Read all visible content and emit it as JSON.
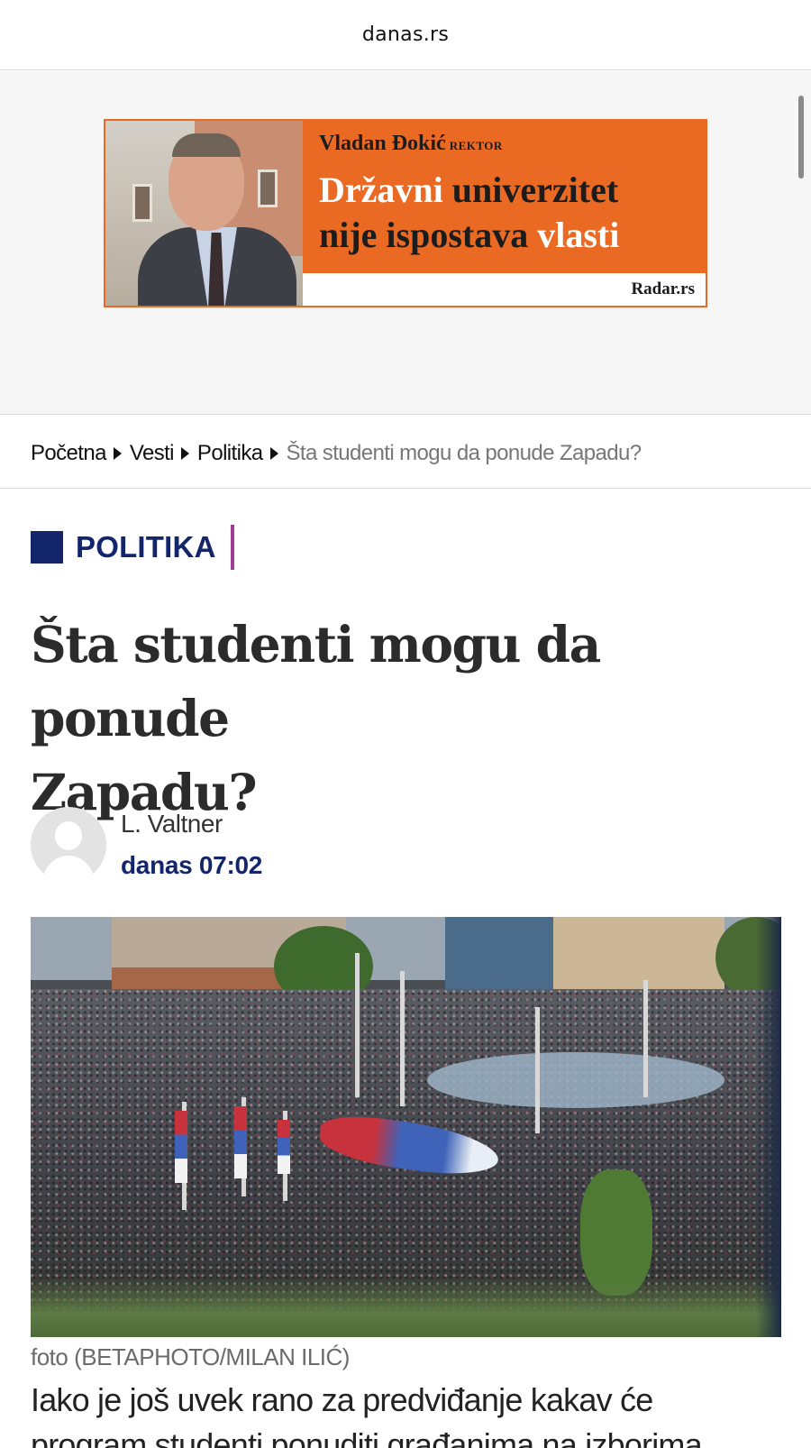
{
  "browser": {
    "url": "danas.rs"
  },
  "ad": {
    "name": "Vladan Đokić",
    "role": "REKTOR",
    "headline_line1_a": "Državni",
    "headline_line1_b": "univerzitet",
    "headline_line2_a": "nije ispostava",
    "headline_line2_b": "vlasti",
    "brand": "Radar.rs",
    "colors": {
      "background": "#ea6a24",
      "text": "#1c1c1c",
      "highlight": "#ffffff"
    }
  },
  "breadcrumb": {
    "items": [
      "Početna",
      "Vesti",
      "Politika"
    ],
    "current": "Šta studenti mogu da ponude Zapadu?"
  },
  "category": {
    "label": "POLITIKA",
    "color": "#14266b",
    "accent": "#a03c93"
  },
  "article": {
    "title_line1": "Šta studenti mogu da ponude",
    "title_line2": "Zapadu?",
    "author": "L. Valtner",
    "date": "danas 07:02",
    "photo_icon": "crowd-protest-photo",
    "caption": "foto (BETAPHOTO/MILAN ILIĆ)",
    "lead_line1": "Iako je još uvek rano za predviđanje kakav će",
    "lead_line2": "program studenti ponuditi građanima na izborima"
  }
}
